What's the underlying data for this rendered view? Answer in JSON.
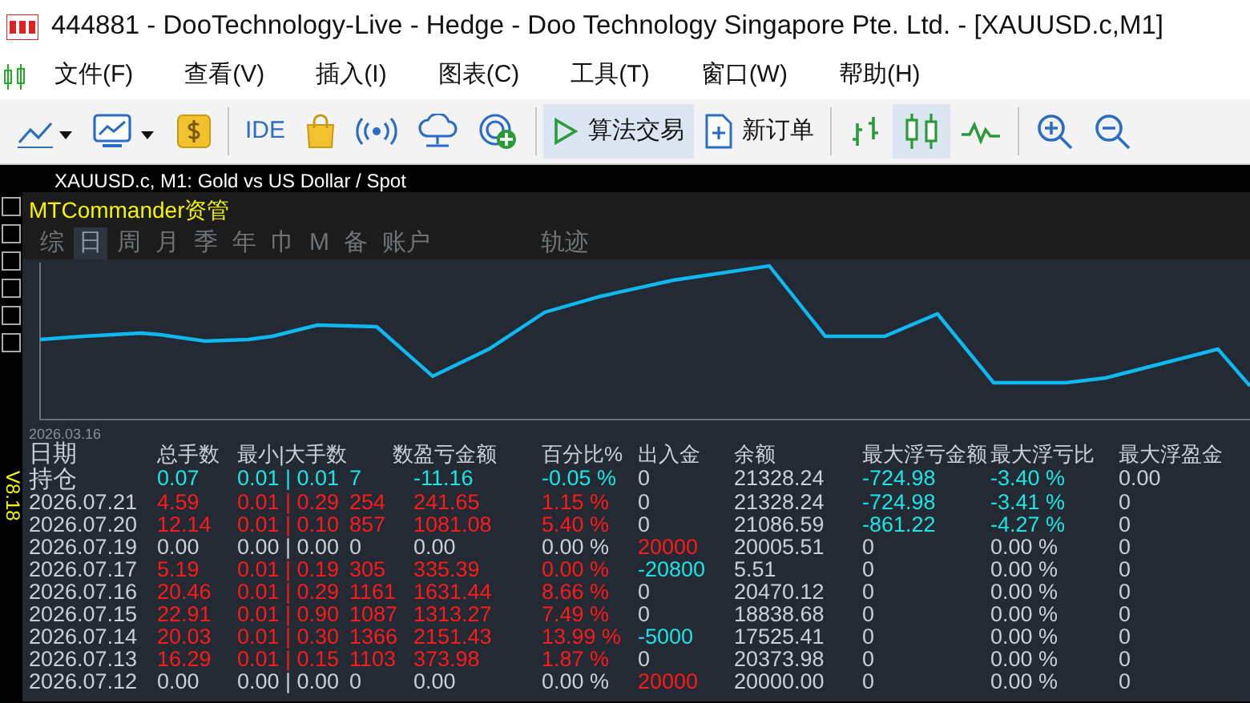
{
  "window": {
    "title": "444881 - DooTechnology-Live - Hedge - Doo Technology Singapore Pte. Ltd. - [XAUUSD.c,M1]"
  },
  "menu": [
    "文件(F)",
    "查看(V)",
    "插入(I)",
    "图表(C)",
    "工具(T)",
    "窗口(W)",
    "帮助(H)"
  ],
  "toolbar": {
    "ide_label": "IDE",
    "algo_button": {
      "label": "算法交易",
      "selected": true
    },
    "order_button": {
      "label": "新订单"
    },
    "candles_selected": true
  },
  "chart_window": {
    "title": "XAUUSD.c, M1:  Gold vs US Dollar / Spot"
  },
  "side_label": "V8.18",
  "panel": {
    "title": "MTCommander资管",
    "tabs": [
      {
        "label": "综",
        "selected": false
      },
      {
        "label": "日",
        "selected": true
      },
      {
        "label": "周",
        "selected": false
      },
      {
        "label": "月",
        "selected": false
      },
      {
        "label": "季",
        "selected": false
      },
      {
        "label": "年",
        "selected": false
      },
      {
        "label": "巾",
        "selected": false
      },
      {
        "label": "M",
        "selected": false
      },
      {
        "label": "备",
        "selected": false
      },
      {
        "label": "账户",
        "selected": false
      },
      {
        "label": "轨迹",
        "selected": false
      }
    ],
    "chart_start_label": "2026.03.16",
    "table": {
      "date_column": "日期",
      "columns": [
        "总手数",
        "最小|大手数",
        "数",
        "盈亏金额",
        "百分比%",
        "出入金",
        "余额",
        "最大浮亏金额",
        "最大浮亏比",
        "最大浮盈金"
      ],
      "rows": [
        {
          "date": "持仓",
          "cells": [
            {
              "text": "0.07",
              "color": "#19e6e6"
            },
            {
              "text": "0.01 | 0.01",
              "color": "#19e6e6"
            },
            {
              "text": "7",
              "color": "#19e6e6"
            },
            {
              "text": "-11.16",
              "color": "#19e6e6"
            },
            {
              "text": "-0.05 %",
              "color": "#19e6e6"
            },
            {
              "text": "0",
              "color": "#c8d0dc"
            },
            {
              "text": "21328.24",
              "color": "#c8d0dc"
            },
            {
              "text": "-724.98",
              "color": "#19e6e6"
            },
            {
              "text": "-3.40 %",
              "color": "#19e6e6"
            },
            {
              "text": "0.00",
              "color": "#c8d0dc"
            }
          ]
        },
        {
          "date": "2026.07.21",
          "cells": [
            {
              "text": "4.59",
              "color": "#ff1a1a"
            },
            {
              "text": "0.01 | 0.29",
              "color": "#ff1a1a"
            },
            {
              "text": "254",
              "color": "#ff1a1a"
            },
            {
              "text": "241.65",
              "color": "#ff1a1a"
            },
            {
              "text": "1.15 %",
              "color": "#ff1a1a"
            },
            {
              "text": "0",
              "color": "#c8d0dc"
            },
            {
              "text": "21328.24",
              "color": "#c8d0dc"
            },
            {
              "text": "-724.98",
              "color": "#19e6e6"
            },
            {
              "text": "-3.41 %",
              "color": "#19e6e6"
            },
            {
              "text": "0",
              "color": "#c8d0dc"
            }
          ]
        },
        {
          "date": "2026.07.20",
          "cells": [
            {
              "text": "12.14",
              "color": "#ff1a1a"
            },
            {
              "text": "0.01 | 0.10",
              "color": "#ff1a1a"
            },
            {
              "text": "857",
              "color": "#ff1a1a"
            },
            {
              "text": "1081.08",
              "color": "#ff1a1a"
            },
            {
              "text": "5.40 %",
              "color": "#ff1a1a"
            },
            {
              "text": "0",
              "color": "#c8d0dc"
            },
            {
              "text": "21086.59",
              "color": "#c8d0dc"
            },
            {
              "text": "-861.22",
              "color": "#19e6e6"
            },
            {
              "text": "-4.27 %",
              "color": "#19e6e6"
            },
            {
              "text": "0",
              "color": "#c8d0dc"
            }
          ]
        },
        {
          "date": "2026.07.19",
          "cells": [
            {
              "text": "0.00",
              "color": "#c8d0dc"
            },
            {
              "text": "0.00 | 0.00",
              "color": "#c8d0dc"
            },
            {
              "text": "0",
              "color": "#c8d0dc"
            },
            {
              "text": "0.00",
              "color": "#c8d0dc"
            },
            {
              "text": "0.00 %",
              "color": "#c8d0dc"
            },
            {
              "text": "20000",
              "color": "#ff1a1a"
            },
            {
              "text": "20005.51",
              "color": "#c8d0dc"
            },
            {
              "text": "0",
              "color": "#c8d0dc"
            },
            {
              "text": "0.00 %",
              "color": "#c8d0dc"
            },
            {
              "text": "0",
              "color": "#c8d0dc"
            }
          ]
        },
        {
          "date": "2026.07.17",
          "cells": [
            {
              "text": "5.19",
              "color": "#ff1a1a"
            },
            {
              "text": "0.01 | 0.19",
              "color": "#ff1a1a"
            },
            {
              "text": "305",
              "color": "#ff1a1a"
            },
            {
              "text": "335.39",
              "color": "#ff1a1a"
            },
            {
              "text": "0.00 %",
              "color": "#ff1a1a"
            },
            {
              "text": "-20800",
              "color": "#19e6e6"
            },
            {
              "text": "5.51",
              "color": "#c8d0dc"
            },
            {
              "text": "0",
              "color": "#c8d0dc"
            },
            {
              "text": "0.00 %",
              "color": "#c8d0dc"
            },
            {
              "text": "0",
              "color": "#c8d0dc"
            }
          ]
        },
        {
          "date": "2026.07.16",
          "cells": [
            {
              "text": "20.46",
              "color": "#ff1a1a"
            },
            {
              "text": "0.01 | 0.29",
              "color": "#ff1a1a"
            },
            {
              "text": "1161",
              "color": "#ff1a1a"
            },
            {
              "text": "1631.44",
              "color": "#ff1a1a"
            },
            {
              "text": "8.66 %",
              "color": "#ff1a1a"
            },
            {
              "text": "0",
              "color": "#c8d0dc"
            },
            {
              "text": "20470.12",
              "color": "#c8d0dc"
            },
            {
              "text": "0",
              "color": "#c8d0dc"
            },
            {
              "text": "0.00 %",
              "color": "#c8d0dc"
            },
            {
              "text": "0",
              "color": "#c8d0dc"
            }
          ]
        },
        {
          "date": "2026.07.15",
          "cells": [
            {
              "text": "22.91",
              "color": "#ff1a1a"
            },
            {
              "text": "0.01 | 0.90",
              "color": "#ff1a1a"
            },
            {
              "text": "1087",
              "color": "#ff1a1a"
            },
            {
              "text": "1313.27",
              "color": "#ff1a1a"
            },
            {
              "text": "7.49 %",
              "color": "#ff1a1a"
            },
            {
              "text": "0",
              "color": "#c8d0dc"
            },
            {
              "text": "18838.68",
              "color": "#c8d0dc"
            },
            {
              "text": "0",
              "color": "#c8d0dc"
            },
            {
              "text": "0.00 %",
              "color": "#c8d0dc"
            },
            {
              "text": "0",
              "color": "#c8d0dc"
            }
          ]
        },
        {
          "date": "2026.07.14",
          "cells": [
            {
              "text": "20.03",
              "color": "#ff1a1a"
            },
            {
              "text": "0.01 | 0.30",
              "color": "#ff1a1a"
            },
            {
              "text": "1366",
              "color": "#ff1a1a"
            },
            {
              "text": "2151.43",
              "color": "#ff1a1a"
            },
            {
              "text": "13.99 %",
              "color": "#ff1a1a"
            },
            {
              "text": "-5000",
              "color": "#19e6e6"
            },
            {
              "text": "17525.41",
              "color": "#c8d0dc"
            },
            {
              "text": "0",
              "color": "#c8d0dc"
            },
            {
              "text": "0.00 %",
              "color": "#c8d0dc"
            },
            {
              "text": "0",
              "color": "#c8d0dc"
            }
          ]
        },
        {
          "date": "2026.07.13",
          "cells": [
            {
              "text": "16.29",
              "color": "#ff1a1a"
            },
            {
              "text": "0.01 | 0.15",
              "color": "#ff1a1a"
            },
            {
              "text": "1103",
              "color": "#ff1a1a"
            },
            {
              "text": "373.98",
              "color": "#ff1a1a"
            },
            {
              "text": "1.87 %",
              "color": "#ff1a1a"
            },
            {
              "text": "0",
              "color": "#c8d0dc"
            },
            {
              "text": "20373.98",
              "color": "#c8d0dc"
            },
            {
              "text": "0",
              "color": "#c8d0dc"
            },
            {
              "text": "0.00 %",
              "color": "#c8d0dc"
            },
            {
              "text": "0",
              "color": "#c8d0dc"
            }
          ]
        },
        {
          "date": "2026.07.12",
          "cells": [
            {
              "text": "0.00",
              "color": "#c8d0dc"
            },
            {
              "text": "0.00 | 0.00",
              "color": "#c8d0dc"
            },
            {
              "text": "0",
              "color": "#c8d0dc"
            },
            {
              "text": "0.00",
              "color": "#c8d0dc"
            },
            {
              "text": "0.00 %",
              "color": "#c8d0dc"
            },
            {
              "text": "20000",
              "color": "#ff1a1a"
            },
            {
              "text": "20000.00",
              "color": "#c8d0dc"
            },
            {
              "text": "0",
              "color": "#c8d0dc"
            },
            {
              "text": "0.00 %",
              "color": "#c8d0dc"
            },
            {
              "text": "0",
              "color": "#c8d0dc"
            }
          ]
        }
      ]
    }
  }
}
